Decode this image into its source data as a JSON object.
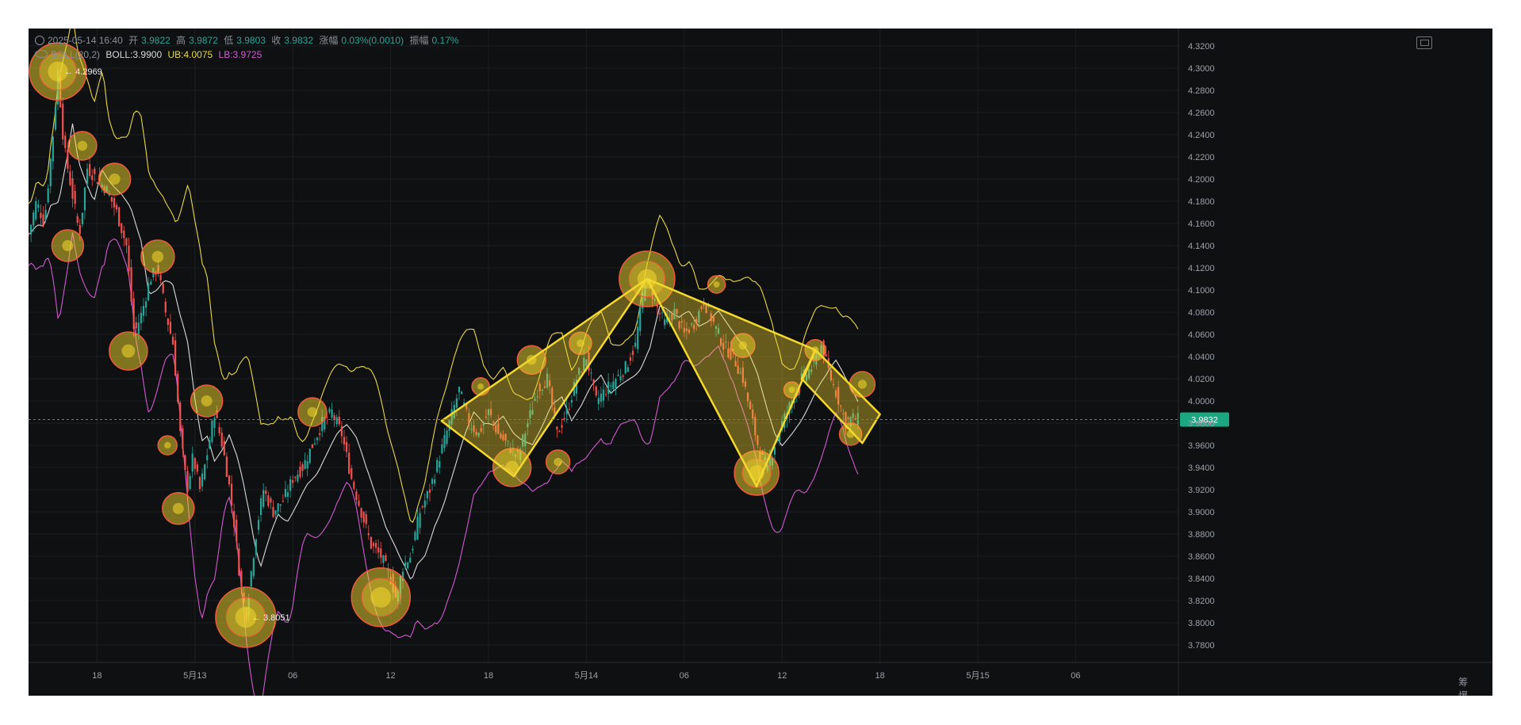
{
  "header": {
    "datetime": "2025-05-14 16:40",
    "open_label": "开",
    "open": "3.9822",
    "high_label": "高",
    "high": "3.9872",
    "low_label": "低",
    "low": "3.9803",
    "close_label": "收",
    "close": "3.9832",
    "change_label": "涨幅",
    "change": "0.03%(0.0010)",
    "amp_label": "振幅",
    "amp": "0.17%",
    "boll_label": "BOLL(20,2)",
    "boll": "BOLL:3.9900",
    "ub": "UB:4.0075",
    "lb": "LB:3.9725"
  },
  "colors": {
    "up": "#26a69a",
    "down": "#ef5350",
    "mid": "#d9d9d9",
    "ub": "#e8d84a",
    "lb": "#d05ad0",
    "highlight": "#f4d82e",
    "ring": "#f05a3c",
    "price_tag": "#1aa782"
  },
  "corner_labels": "筹 爆",
  "chart_data": {
    "type": "candlestick",
    "title": "",
    "y_range": [
      3.77,
      4.33
    ],
    "y_ticks": [
      "4.3200",
      "4.3000",
      "4.2800",
      "4.2600",
      "4.2400",
      "4.2200",
      "4.2000",
      "4.1800",
      "4.1600",
      "4.1400",
      "4.1200",
      "4.1000",
      "4.0800",
      "4.0600",
      "4.0400",
      "4.0200",
      "4.0000",
      "3.9800",
      "3.9600",
      "3.9400",
      "3.9200",
      "3.9000",
      "3.8800",
      "3.8600",
      "3.8400",
      "3.8200",
      "3.8000",
      "3.7800"
    ],
    "x_ticks": [
      {
        "label": "18",
        "t": 7
      },
      {
        "label": "5月13",
        "t": 17
      },
      {
        "label": "06",
        "t": 27
      },
      {
        "label": "12",
        "t": 37
      },
      {
        "label": "18",
        "t": 47
      },
      {
        "label": "5月14",
        "t": 57
      },
      {
        "label": "06",
        "t": 67
      },
      {
        "label": "12",
        "t": 77
      },
      {
        "label": "18",
        "t": 87
      },
      {
        "label": "5月15",
        "t": 97
      },
      {
        "label": "06",
        "t": 107
      }
    ],
    "x_range": [
      0,
      117.5
    ],
    "last_price": "3.9832",
    "max_label": "4.2969",
    "min_label": "3.8051",
    "price_path": [
      [
        0,
        4.15
      ],
      [
        0.8,
        4.18
      ],
      [
        1.6,
        4.16
      ],
      [
        2.5,
        4.24
      ],
      [
        3.0,
        4.297
      ],
      [
        3.6,
        4.23
      ],
      [
        4.4,
        4.19
      ],
      [
        5.2,
        4.15
      ],
      [
        6.0,
        4.21
      ],
      [
        7.0,
        4.2
      ],
      [
        8.0,
        4.19
      ],
      [
        9.0,
        4.17
      ],
      [
        10.0,
        4.14
      ],
      [
        10.8,
        4.06
      ],
      [
        11.6,
        4.08
      ],
      [
        12.4,
        4.11
      ],
      [
        13.2,
        4.12
      ],
      [
        14.0,
        4.08
      ],
      [
        14.8,
        4.05
      ],
      [
        15.5,
        3.97
      ],
      [
        16.2,
        3.92
      ],
      [
        16.8,
        3.95
      ],
      [
        17.5,
        3.92
      ],
      [
        18.2,
        3.95
      ],
      [
        19.0,
        3.99
      ],
      [
        19.8,
        3.96
      ],
      [
        20.4,
        3.93
      ],
      [
        21.0,
        3.89
      ],
      [
        21.6,
        3.84
      ],
      [
        22.2,
        3.805
      ],
      [
        22.8,
        3.85
      ],
      [
        23.4,
        3.89
      ],
      [
        24.0,
        3.92
      ],
      [
        25.0,
        3.9
      ],
      [
        26.0,
        3.91
      ],
      [
        27.0,
        3.93
      ],
      [
        28.0,
        3.94
      ],
      [
        29.0,
        3.96
      ],
      [
        30.0,
        3.98
      ],
      [
        31.0,
        3.99
      ],
      [
        32.0,
        3.97
      ],
      [
        33.0,
        3.93
      ],
      [
        34.0,
        3.9
      ],
      [
        35.0,
        3.87
      ],
      [
        36.0,
        3.86
      ],
      [
        37.0,
        3.84
      ],
      [
        37.6,
        3.82
      ],
      [
        38.2,
        3.85
      ],
      [
        39.0,
        3.86
      ],
      [
        40.0,
        3.9
      ],
      [
        41.0,
        3.92
      ],
      [
        42.0,
        3.95
      ],
      [
        43.0,
        3.98
      ],
      [
        44.0,
        4.01
      ],
      [
        45.0,
        3.98
      ],
      [
        46.0,
        3.97
      ],
      [
        47.0,
        3.99
      ],
      [
        48.0,
        3.97
      ],
      [
        49.0,
        3.96
      ],
      [
        50.0,
        3.95
      ],
      [
        51.0,
        3.98
      ],
      [
        52.0,
        4.01
      ],
      [
        53.0,
        4.02
      ],
      [
        54.0,
        3.97
      ],
      [
        55.0,
        3.99
      ],
      [
        56.0,
        4.02
      ],
      [
        57.0,
        4.04
      ],
      [
        58.0,
        4.0
      ],
      [
        59.0,
        4.01
      ],
      [
        60.0,
        4.02
      ],
      [
        61.0,
        4.03
      ],
      [
        62.0,
        4.05
      ],
      [
        63.0,
        4.11
      ],
      [
        63.6,
        4.1
      ],
      [
        64.4,
        4.08
      ],
      [
        65.0,
        4.07
      ],
      [
        66.0,
        4.08
      ],
      [
        67.0,
        4.06
      ],
      [
        68.0,
        4.07
      ],
      [
        69.0,
        4.09
      ],
      [
        70.0,
        4.07
      ],
      [
        71.0,
        4.05
      ],
      [
        72.0,
        4.04
      ],
      [
        73.0,
        4.02
      ],
      [
        74.0,
        3.98
      ],
      [
        74.8,
        3.95
      ],
      [
        75.5,
        3.94
      ],
      [
        76.2,
        3.96
      ],
      [
        77.0,
        3.98
      ],
      [
        78.0,
        4.0
      ],
      [
        79.0,
        4.02
      ],
      [
        80.0,
        4.03
      ],
      [
        81.0,
        4.05
      ],
      [
        82.0,
        4.02
      ],
      [
        82.8,
        4.0
      ],
      [
        83.5,
        3.98
      ],
      [
        84.2,
        3.985
      ],
      [
        84.8,
        3.983
      ]
    ],
    "highlight_points": [
      [
        3.0,
        4.297,
        36
      ],
      [
        4.0,
        4.14,
        20
      ],
      [
        5.5,
        4.23,
        18
      ],
      [
        8.8,
        4.2,
        20
      ],
      [
        13.2,
        4.13,
        21
      ],
      [
        10.2,
        4.045,
        24
      ],
      [
        14.2,
        3.96,
        12
      ],
      [
        15.3,
        3.903,
        20
      ],
      [
        18.2,
        4.0,
        20
      ],
      [
        22.2,
        3.805,
        38
      ],
      [
        29.0,
        3.99,
        18
      ],
      [
        36.0,
        3.823,
        37
      ],
      [
        46.2,
        4.013,
        11
      ],
      [
        49.4,
        3.94,
        24
      ],
      [
        51.4,
        4.037,
        18
      ],
      [
        54.1,
        3.945,
        15
      ],
      [
        56.4,
        4.052,
        14
      ],
      [
        63.2,
        4.11,
        35
      ],
      [
        70.3,
        4.105,
        11
      ],
      [
        73.0,
        4.05,
        15
      ],
      [
        74.4,
        3.935,
        28
      ],
      [
        78.0,
        4.01,
        10
      ],
      [
        80.4,
        4.046,
        13
      ],
      [
        84.0,
        3.97,
        14
      ],
      [
        85.2,
        4.015,
        16
      ]
    ],
    "polygons": [
      [
        [
          42.2,
          3.982
        ],
        [
          63.2,
          4.11
        ],
        [
          49.6,
          3.932
        ],
        [
          42.2,
          3.982
        ]
      ],
      [
        [
          63.2,
          4.11
        ],
        [
          80.4,
          4.046
        ],
        [
          74.4,
          3.923
        ],
        [
          63.2,
          4.11
        ]
      ],
      [
        [
          80.4,
          4.046
        ],
        [
          87.0,
          3.988
        ],
        [
          85.2,
          3.962
        ],
        [
          79.0,
          4.02
        ]
      ]
    ]
  }
}
